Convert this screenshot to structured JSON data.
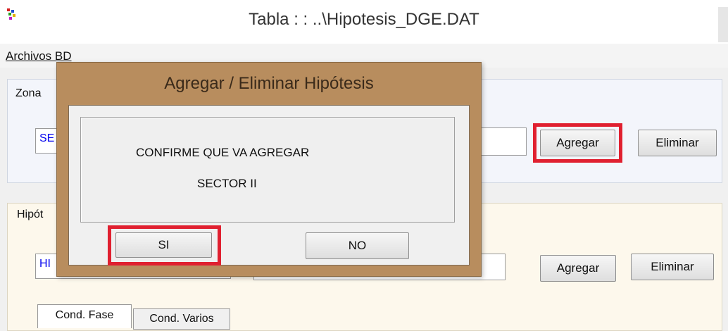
{
  "window": {
    "title": "Tabla : : ..\\Hipotesis_DGE.DAT",
    "app_icon": "multicolor-app-icon"
  },
  "menu": {
    "archivos_bd": "Archivos BD"
  },
  "zona": {
    "legend": "Zona",
    "combo_value": "SE",
    "agregar": "Agregar",
    "eliminar": "Eliminar"
  },
  "hipotesis": {
    "legend": "Hipót",
    "combo_value": "HI",
    "agregar": "Agregar",
    "eliminar": "Eliminar",
    "tabs": [
      "Cond. Fase",
      "Cond. Varios"
    ]
  },
  "dialog": {
    "title": "Agregar / Eliminar Hipótesis",
    "message_line1": "CONFIRME QUE VA AGREGAR",
    "message_line2": "SECTOR II",
    "yes_label": "SI",
    "no_label": "NO"
  },
  "colors": {
    "dialog_frame": "#b88d5e",
    "highlight": "#e02030",
    "link_blue": "#0000ee"
  }
}
